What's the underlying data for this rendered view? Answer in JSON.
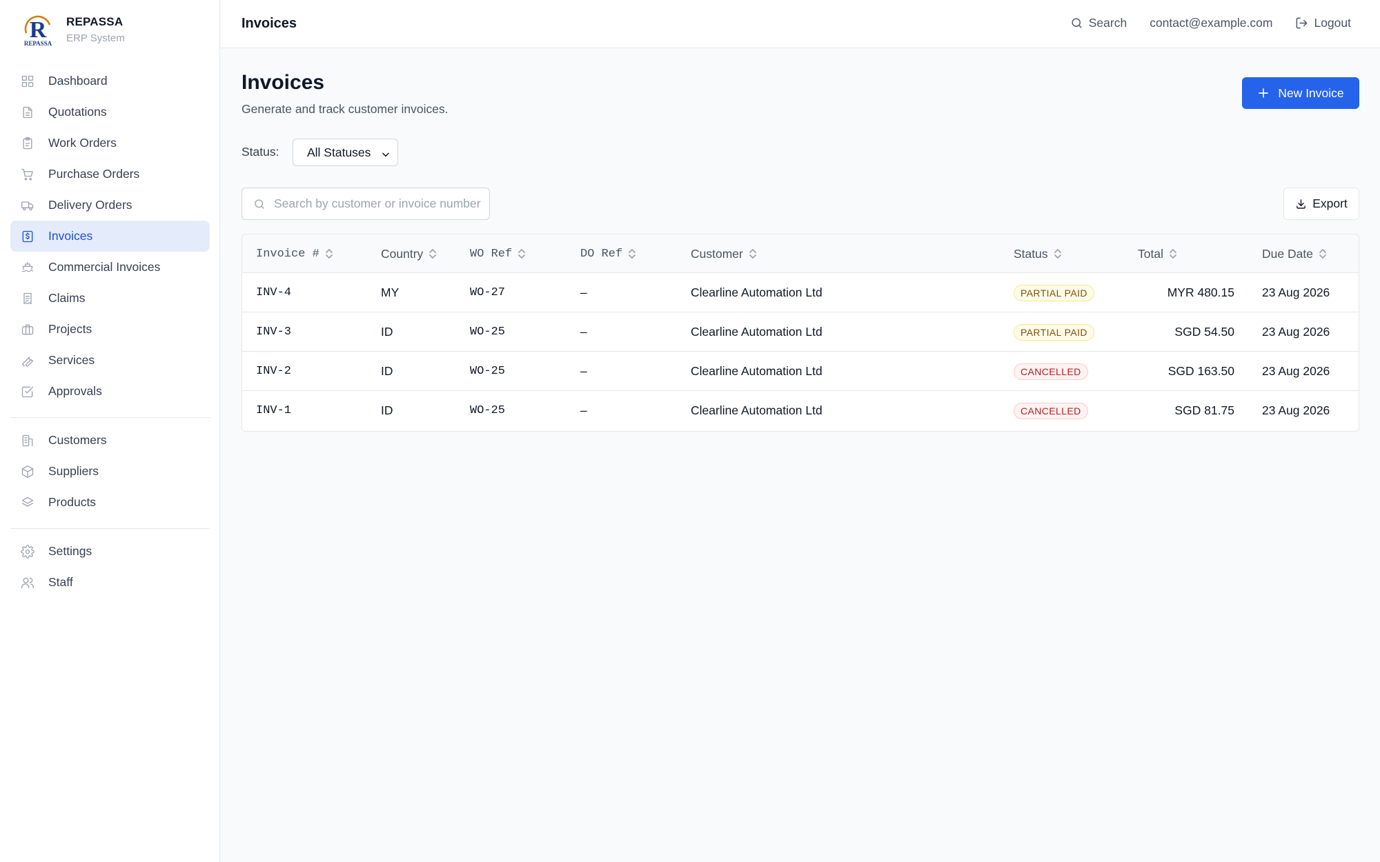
{
  "brand": {
    "name": "REPASSA",
    "subtitle": "ERP System",
    "logo_letter": "R",
    "logo_text": "REPASSA"
  },
  "sidebar": {
    "items": [
      {
        "label": "Dashboard",
        "icon": "grid-icon"
      },
      {
        "label": "Quotations",
        "icon": "document-icon"
      },
      {
        "label": "Work Orders",
        "icon": "clipboard-icon"
      },
      {
        "label": "Purchase Orders",
        "icon": "cart-icon"
      },
      {
        "label": "Delivery Orders",
        "icon": "truck-icon"
      },
      {
        "label": "Invoices",
        "icon": "dollar-receipt-icon",
        "active": true
      },
      {
        "label": "Commercial Invoices",
        "icon": "ship-icon"
      },
      {
        "label": "Claims",
        "icon": "receipt-icon"
      },
      {
        "label": "Projects",
        "icon": "briefcase-icon"
      },
      {
        "label": "Services",
        "icon": "wrench-icon"
      },
      {
        "label": "Approvals",
        "icon": "check-square-icon"
      }
    ],
    "section2": [
      {
        "label": "Customers",
        "icon": "building-icon"
      },
      {
        "label": "Suppliers",
        "icon": "package-icon"
      },
      {
        "label": "Products",
        "icon": "layers-icon"
      }
    ],
    "section3": [
      {
        "label": "Settings",
        "icon": "gear-icon"
      },
      {
        "label": "Staff",
        "icon": "users-icon"
      }
    ]
  },
  "header": {
    "title": "Invoices",
    "search_label": "Search",
    "user_email": "contact@example.com",
    "logout_label": "Logout"
  },
  "main": {
    "title": "Invoices",
    "subtitle": "Generate and track customer invoices.",
    "new_button": "New Invoice",
    "status_label": "Status:",
    "status_selected": "All Statuses",
    "search_placeholder": "Search by customer or invoice number",
    "export_label": "Export"
  },
  "table": {
    "columns": [
      "Invoice #",
      "Country",
      "WO Ref",
      "DO Ref",
      "Customer",
      "Status",
      "Total",
      "Due Date"
    ],
    "rows": [
      {
        "invoice": "INV-4",
        "country": "MY",
        "wo_ref": "WO-27",
        "do_ref": "–",
        "customer": "Clearline Automation Ltd",
        "status": "PARTIAL PAID",
        "total": "MYR 480.15",
        "due": "23 Aug 2026"
      },
      {
        "invoice": "INV-3",
        "country": "ID",
        "wo_ref": "WO-25",
        "do_ref": "–",
        "customer": "Clearline Automation Ltd",
        "status": "PARTIAL PAID",
        "total": "SGD 54.50",
        "due": "23 Aug 2026"
      },
      {
        "invoice": "INV-2",
        "country": "ID",
        "wo_ref": "WO-25",
        "do_ref": "–",
        "customer": "Clearline Automation Ltd",
        "status": "CANCELLED",
        "total": "SGD 163.50",
        "due": "23 Aug 2026"
      },
      {
        "invoice": "INV-1",
        "country": "ID",
        "wo_ref": "WO-25",
        "do_ref": "–",
        "customer": "Clearline Automation Ltd",
        "status": "CANCELLED",
        "total": "SGD 81.75",
        "due": "23 Aug 2026"
      }
    ]
  },
  "colors": {
    "accent": "#2563eb",
    "active_bg": "#e4ecfb",
    "partial_badge": "#854d0e",
    "cancelled_badge": "#b91c1c"
  }
}
